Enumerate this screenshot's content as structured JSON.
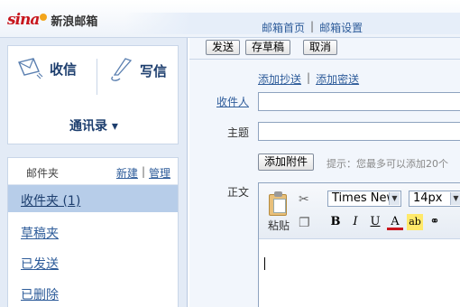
{
  "header": {
    "logo_mark": "sina",
    "logo_text": "新浪邮箱",
    "links": [
      "邮箱首页",
      "邮箱设置"
    ],
    "link_separator": "|"
  },
  "sidebar": {
    "receive_label": "收信",
    "write_label": "写信",
    "contacts_label": "通讯录 ▾",
    "folder_title": "邮件夹",
    "new_label": "新建",
    "manage_label": "管理",
    "folders": [
      {
        "label": "收件夹 (1)",
        "active": true
      },
      {
        "label": "草稿夹",
        "active": false
      },
      {
        "label": "已发送",
        "active": false
      },
      {
        "label": "已删除",
        "active": false
      }
    ]
  },
  "compose": {
    "send_label": "发送",
    "save_draft_label": "存草稿",
    "cancel_label": "取消",
    "add_cc_label": "添加抄送",
    "add_bcc_label": "添加密送",
    "separator": "|",
    "to_label": "收件人",
    "subject_label": "主题",
    "attach_label": "添加附件",
    "attach_hint": "提示：您最多可以添加20个",
    "body_label": "正文",
    "to_value": "",
    "subject_value": ""
  },
  "editor": {
    "paste_label": "粘贴",
    "font_family": "Times New",
    "font_size": "14px",
    "bold": "B",
    "italic": "I",
    "underline": "U",
    "font_color": "A",
    "highlight": "ab"
  },
  "colors": {
    "accent": "#2e5c9a",
    "sidebar_bg": "#e3ebf6",
    "active_folder": "#b7cde9",
    "logo_red": "#c8161d"
  },
  "icons": {
    "receive": "envelope-icon",
    "write": "pen-icon",
    "cut": "scissors-icon",
    "copy": "copy-icon",
    "link": "link-icon"
  }
}
